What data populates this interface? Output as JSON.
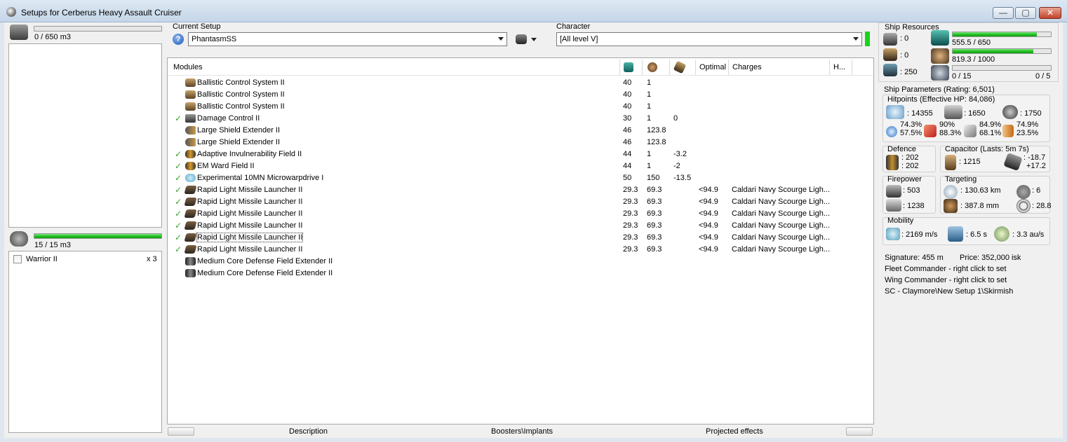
{
  "window": {
    "title": "Setups for Cerberus Heavy Assault Cruiser",
    "minimize": "—",
    "maximize": "▢",
    "close": "✕"
  },
  "cargo": {
    "label": "0 / 650 m3",
    "fill_fraction": 0.0
  },
  "drone_bay": {
    "label": "15 / 15 m3",
    "fill_fraction": 1.0,
    "items": [
      {
        "name": "Warrior II",
        "qty": "x 3",
        "checked": false
      }
    ]
  },
  "current_setup": {
    "label": "Current Setup",
    "value": "PhantasmSS",
    "help": "?"
  },
  "character": {
    "label": "Character",
    "value": "[All level V]",
    "status_color": "#18d418"
  },
  "modules_table": {
    "headers": {
      "modules": "Modules",
      "optimal": "Optimal",
      "charges": "Charges",
      "h": "H..."
    },
    "rows": [
      {
        "icon": "bcs",
        "check": false,
        "name": "Ballistic Control System II",
        "cpu": "40",
        "pg": "1",
        "cap": "",
        "optimal": "",
        "charge": ""
      },
      {
        "icon": "bcs",
        "check": false,
        "name": "Ballistic Control System II",
        "cpu": "40",
        "pg": "1",
        "cap": "",
        "optimal": "",
        "charge": ""
      },
      {
        "icon": "bcs",
        "check": false,
        "name": "Ballistic Control System II",
        "cpu": "40",
        "pg": "1",
        "cap": "",
        "optimal": "",
        "charge": ""
      },
      {
        "icon": "dc",
        "check": true,
        "name": "Damage Control II",
        "cpu": "30",
        "pg": "1",
        "cap": "0",
        "optimal": "",
        "charge": ""
      },
      {
        "icon": "lse",
        "check": false,
        "name": "Large Shield Extender II",
        "cpu": "46",
        "pg": "123.8",
        "cap": "",
        "optimal": "",
        "charge": ""
      },
      {
        "icon": "lse",
        "check": false,
        "name": "Large Shield Extender II",
        "cpu": "46",
        "pg": "123.8",
        "cap": "",
        "optimal": "",
        "charge": ""
      },
      {
        "icon": "ainv",
        "check": true,
        "name": "Adaptive Invulnerability Field II",
        "cpu": "44",
        "pg": "1",
        "cap": "-3.2",
        "optimal": "",
        "charge": ""
      },
      {
        "icon": "ainv",
        "check": true,
        "name": "EM Ward Field II",
        "cpu": "44",
        "pg": "1",
        "cap": "-2",
        "optimal": "",
        "charge": ""
      },
      {
        "icon": "mwd",
        "check": true,
        "name": "Experimental 10MN Microwarpdrive I",
        "cpu": "50",
        "pg": "150",
        "cap": "-13.5",
        "optimal": "",
        "charge": ""
      },
      {
        "icon": "launcher",
        "check": true,
        "name": "Rapid Light Missile Launcher II",
        "cpu": "29.3",
        "pg": "69.3",
        "cap": "",
        "optimal": "<94.9",
        "charge": "Caldari Navy Scourge Ligh..."
      },
      {
        "icon": "launcher",
        "check": true,
        "name": "Rapid Light Missile Launcher II",
        "cpu": "29.3",
        "pg": "69.3",
        "cap": "",
        "optimal": "<94.9",
        "charge": "Caldari Navy Scourge Ligh..."
      },
      {
        "icon": "launcher",
        "check": true,
        "name": "Rapid Light Missile Launcher II",
        "cpu": "29.3",
        "pg": "69.3",
        "cap": "",
        "optimal": "<94.9",
        "charge": "Caldari Navy Scourge Ligh..."
      },
      {
        "icon": "launcher",
        "check": true,
        "name": "Rapid Light Missile Launcher II",
        "cpu": "29.3",
        "pg": "69.3",
        "cap": "",
        "optimal": "<94.9",
        "charge": "Caldari Navy Scourge Ligh..."
      },
      {
        "icon": "launcher",
        "check": true,
        "name": "Rapid Light Missile Launcher II",
        "cpu": "29.3",
        "pg": "69.3",
        "cap": "",
        "optimal": "<94.9",
        "charge": "Caldari Navy Scourge Ligh..."
      },
      {
        "icon": "launcher",
        "check": true,
        "name": "Rapid Light Missile Launcher II",
        "cpu": "29.3",
        "pg": "69.3",
        "cap": "",
        "optimal": "<94.9",
        "charge": "Caldari Navy Scourge Ligh..."
      },
      {
        "icon": "mcdfe",
        "check": false,
        "name": "Medium Core Defense Field Extender II",
        "cpu": "",
        "pg": "",
        "cap": "",
        "optimal": "",
        "charge": ""
      },
      {
        "icon": "mcdfe",
        "check": false,
        "name": "Medium Core Defense Field Extender II",
        "cpu": "",
        "pg": "",
        "cap": "",
        "optimal": "",
        "charge": ""
      }
    ]
  },
  "bottom_tabs": {
    "description": "Description",
    "boosters": "Boosters\\Implants",
    "projected": "Projected effects"
  },
  "ship_resources": {
    "title": "Ship Resources",
    "turret_free": ": 0",
    "launcher_free": ": 0",
    "calibration": ": 250",
    "cpu_label": "555.5 / 650",
    "cpu_fraction": 0.855,
    "pg_label": "819.3 / 1000",
    "pg_fraction": 0.819,
    "drone_bw_label": "0 / 15",
    "drones_label": "0 / 5"
  },
  "ship_parameters": {
    "title": "Ship Parameters (Rating: 6,501)",
    "hitpoints_title": "Hitpoints (Effective HP: 84,086)",
    "shield_hp": ": 14355",
    "armor_hp": ": 1650",
    "structure_hp": ": 1750",
    "res_em_top": "74.3%",
    "res_em_bot": "57.5%",
    "res_th_top": "90%",
    "res_th_bot": "88.3%",
    "res_ki_top": "84.9%",
    "res_ki_bot": "68.1%",
    "res_ex_top": "74.9%",
    "res_ex_bot": "23.5%",
    "defence_title": "Defence",
    "defence_1": ": 202",
    "defence_2": ": 202",
    "capacitor_title": "Capacitor (Lasts: 5m 7s)",
    "capacitor_val": ": 1215",
    "cap_rate_1": ": -18.7",
    "cap_rate_2": "+17.2",
    "firepower_title": "Firepower",
    "firepower_1": ": 503",
    "firepower_2": ": 1238",
    "targeting_title": "Targeting",
    "target_range": ": 130.63 km",
    "max_targets": ": 6",
    "scan_res": ": 387.8 mm",
    "sensor_strength": ": 28.8",
    "mobility_title": "Mobility",
    "velocity": ": 2169 m/s",
    "align": ": 6.5 s",
    "warp": ": 3.3 au/s",
    "signature": "Signature: 455 m",
    "price": "Price: 352,000 isk",
    "fleet_cmd": "Fleet Commander - right click to set",
    "wing_cmd": "Wing Commander - right click to set",
    "sc": "SC - Claymore\\New Setup 1\\Skirmish"
  }
}
